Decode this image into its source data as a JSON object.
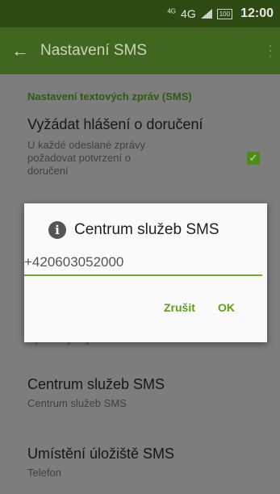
{
  "status_bar": {
    "network_super": "4G",
    "network_main": "4G",
    "battery": "100",
    "time": "12:00"
  },
  "app_bar": {
    "title": "Nastavení SMS"
  },
  "section": {
    "header": "Nastavení textových zpráv (SMS)"
  },
  "preferences": [
    {
      "title": "Vyžádat hlášení o doručení",
      "summary_lines": [
        "U každé odeslané zprávy",
        "požadovat potvrzení o",
        "doručení"
      ],
      "checked": true
    },
    {
      "title": "",
      "summary": "Upravit rychlý text"
    },
    {
      "title": "Centrum služeb SMS",
      "summary": "Centrum služeb SMS"
    },
    {
      "title": "Umístění úložiště SMS",
      "summary": "Telefon"
    }
  ],
  "dialog": {
    "title": "Centrum služeb SMS",
    "input_value": "+420603052000",
    "cancel_label": "Zrušit",
    "ok_label": "OK"
  },
  "colors": {
    "accent": "#6fae2a",
    "app_bar": "#40661f",
    "status_bar": "#2d4a12"
  }
}
